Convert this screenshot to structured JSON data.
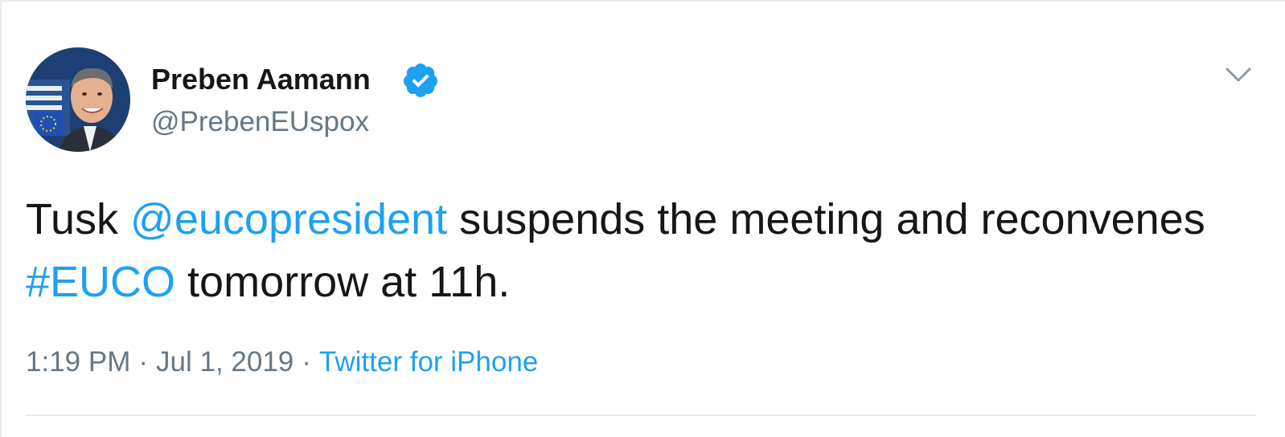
{
  "tweet": {
    "author": {
      "display_name": "Preben Aamann",
      "handle": "@PrebenEUspox",
      "verified": true,
      "avatar_icon": "avatar-photo"
    },
    "text": {
      "prefix": "Tusk ",
      "mention": "@eucopresident",
      "middle": " suspends the meeting and reconvenes ",
      "hashtag": "#EUCO",
      "suffix": " tomorrow at 11h."
    },
    "time": "1:19 PM",
    "separator": "·",
    "date": "Jul 1, 2019",
    "source": "Twitter for iPhone"
  },
  "colors": {
    "link": "#1da1f2",
    "text": "#14171a",
    "muted": "#657786",
    "divider": "#e6ecf0"
  },
  "icons": {
    "verified": "verified-badge-icon",
    "caret": "chevron-down-icon"
  }
}
